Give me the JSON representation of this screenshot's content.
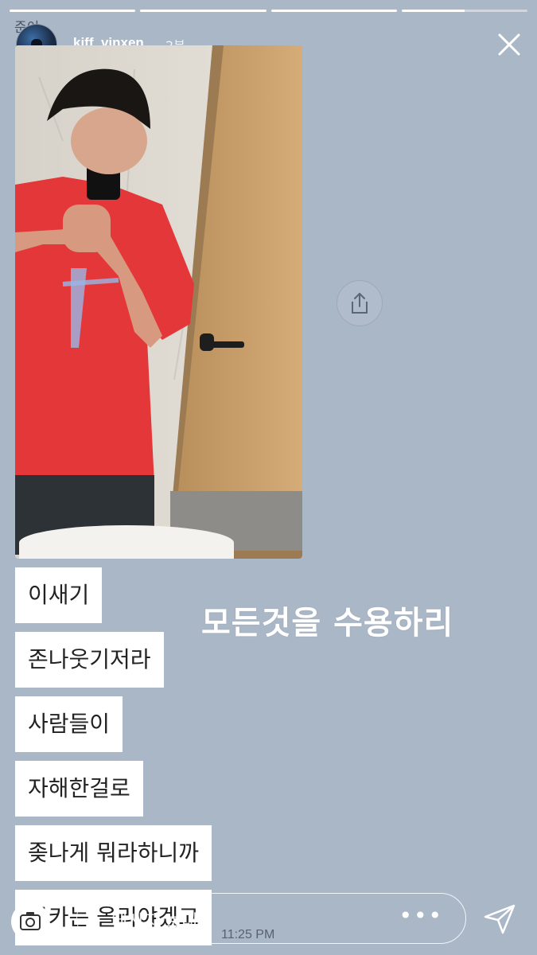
{
  "story": {
    "progress_segments": [
      1,
      1,
      1,
      0.5
    ],
    "prev_label": "준이",
    "username": "kiff_vinxen",
    "time_ago": "2분"
  },
  "caption": "모든것을 수용하리",
  "messages": [
    {
      "text": "이새기"
    },
    {
      "text": "존나웃기저라"
    },
    {
      "text": "사람들이"
    },
    {
      "text": "자해한걸로"
    },
    {
      "text": "좆나게 뭐라하니까"
    },
    {
      "text": "몰카는 올리야겠고"
    }
  ],
  "footer": {
    "reply_placeholder": "메시지 보내기",
    "timestamp": "11:25 PM"
  },
  "icons": {
    "close": "close-icon",
    "share": "share-icon",
    "camera": "camera-icon",
    "more": "more-icon",
    "send": "send-icon"
  }
}
